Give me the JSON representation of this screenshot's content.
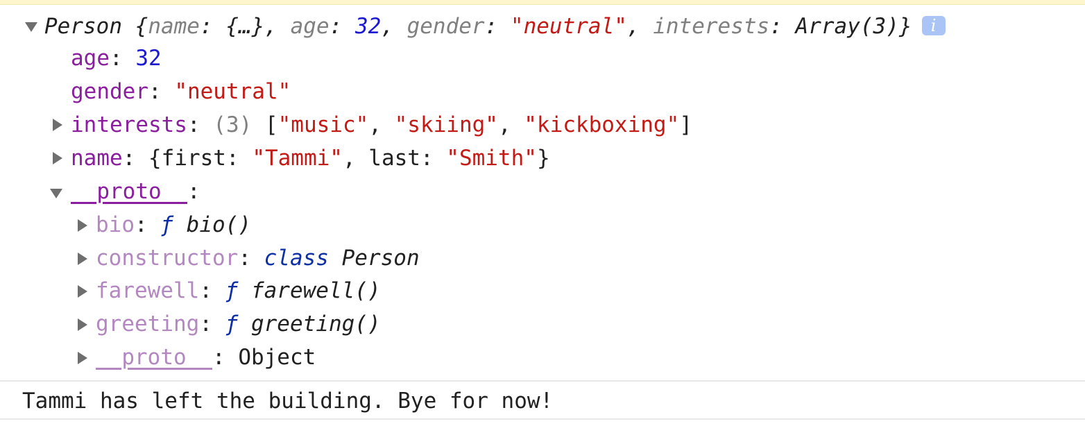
{
  "summary": {
    "class_name": "Person",
    "open_brace": " {",
    "k_name": "name",
    "v_name": "{…}",
    "k_age": "age",
    "v_age": "32",
    "k_gender": "gender",
    "v_gender": "\"neutral\"",
    "k_interests": "interests",
    "v_interests": "Array(3)",
    "close_brace": "}",
    "info_icon_glyph": "i"
  },
  "props": {
    "age": {
      "key": "age",
      "value": "32"
    },
    "gender": {
      "key": "gender",
      "value": "\"neutral\""
    },
    "interests": {
      "key": "interests",
      "length": "(3)",
      "items": [
        "\"music\"",
        "\"skiing\"",
        "\"kickboxing\""
      ]
    },
    "name": {
      "key": "name",
      "k_first": "first",
      "v_first": "\"Tammi\"",
      "k_last": "last",
      "v_last": "\"Smith\""
    },
    "proto": {
      "key": "__proto__"
    }
  },
  "proto_members": {
    "bio": {
      "key": "bio",
      "f": "ƒ",
      "sig": "bio()"
    },
    "constructor": {
      "key": "constructor",
      "kw": "class",
      "name": "Person"
    },
    "farewell": {
      "key": "farewell",
      "f": "ƒ",
      "sig": "farewell()"
    },
    "greeting": {
      "key": "greeting",
      "f": "ƒ",
      "sig": "greeting()"
    },
    "proto": {
      "key": "__proto__",
      "value": "Object"
    }
  },
  "log": {
    "message": "Tammi has left the building. Bye for now!"
  },
  "colors": {
    "key": "#8a1e9f",
    "inherited_key": "#b387c0",
    "number": "#1c1ad0",
    "string": "#c41a16",
    "keyword": "#0d2fa6",
    "info_badge": "#a9c4f5"
  }
}
